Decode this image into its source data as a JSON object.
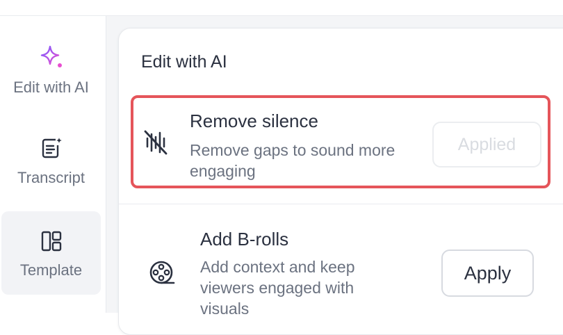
{
  "sidebar": {
    "items": [
      {
        "label": "Edit with AI",
        "icon": "sparkle-icon",
        "active": false
      },
      {
        "label": "Transcript",
        "icon": "transcript-icon",
        "active": false
      },
      {
        "label": "Template",
        "icon": "template-icon",
        "active": true
      }
    ]
  },
  "panel": {
    "title": "Edit with AI",
    "features": [
      {
        "title": "Remove silence",
        "description": "Remove gaps to sound more engaging",
        "icon": "mute-waveform-icon",
        "button_label": "Applied",
        "button_state": "disabled",
        "highlighted": true
      },
      {
        "title": "Add B-rolls",
        "description": "Add context and keep viewers engaged with visuals",
        "icon": "film-reel-icon",
        "button_label": "Apply",
        "button_state": "enabled",
        "highlighted": false
      }
    ]
  },
  "colors": {
    "accent_gradient_start": "#7c5cff",
    "accent_gradient_end": "#e84fd0",
    "highlight_border": "#e5555a",
    "text_primary": "#2b3140",
    "text_secondary": "#6b7280"
  }
}
